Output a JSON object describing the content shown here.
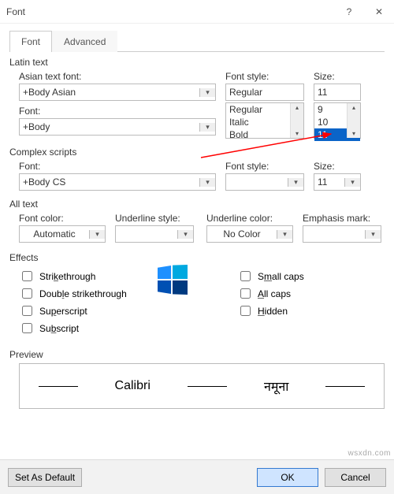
{
  "window": {
    "title": "Font"
  },
  "tabs": {
    "font": "Font",
    "advanced": "Advanced"
  },
  "latin": {
    "group": "Latin text",
    "asian_label": "Asian text font:",
    "asian_value": "+Body Asian",
    "font_label": "Font:",
    "font_value": "+Body",
    "style_label": "Font style:",
    "style_value": "Regular",
    "style_options": [
      "Regular",
      "Italic",
      "Bold"
    ],
    "size_label": "Size:",
    "size_value": "11",
    "size_options": [
      "9",
      "10",
      "11"
    ]
  },
  "complex": {
    "group": "Complex scripts",
    "font_label": "Font:",
    "font_value": "+Body CS",
    "style_label": "Font style:",
    "style_value": "",
    "size_label": "Size:",
    "size_value": "11"
  },
  "alltext": {
    "group": "All text",
    "fontcolor_label": "Font color:",
    "fontcolor_value": "Automatic",
    "ustyle_label": "Underline style:",
    "ustyle_value": "",
    "ucolor_label": "Underline color:",
    "ucolor_value": "No Color",
    "emph_label": "Emphasis mark:",
    "emph_value": ""
  },
  "effects": {
    "group": "Effects",
    "strike": "Strikethrough",
    "dstrike": "Double strikethrough",
    "superscript": "Superscript",
    "subscript": "Subscript",
    "smallcaps": "Small caps",
    "allcaps": "All caps",
    "hidden": "Hidden"
  },
  "preview": {
    "group": "Preview",
    "sample_latin": "Calibri",
    "sample_complex": "नमूना"
  },
  "footer": {
    "setdefault": "Set As Default",
    "ok": "OK",
    "cancel": "Cancel"
  },
  "watermark": "wsxdn.com"
}
